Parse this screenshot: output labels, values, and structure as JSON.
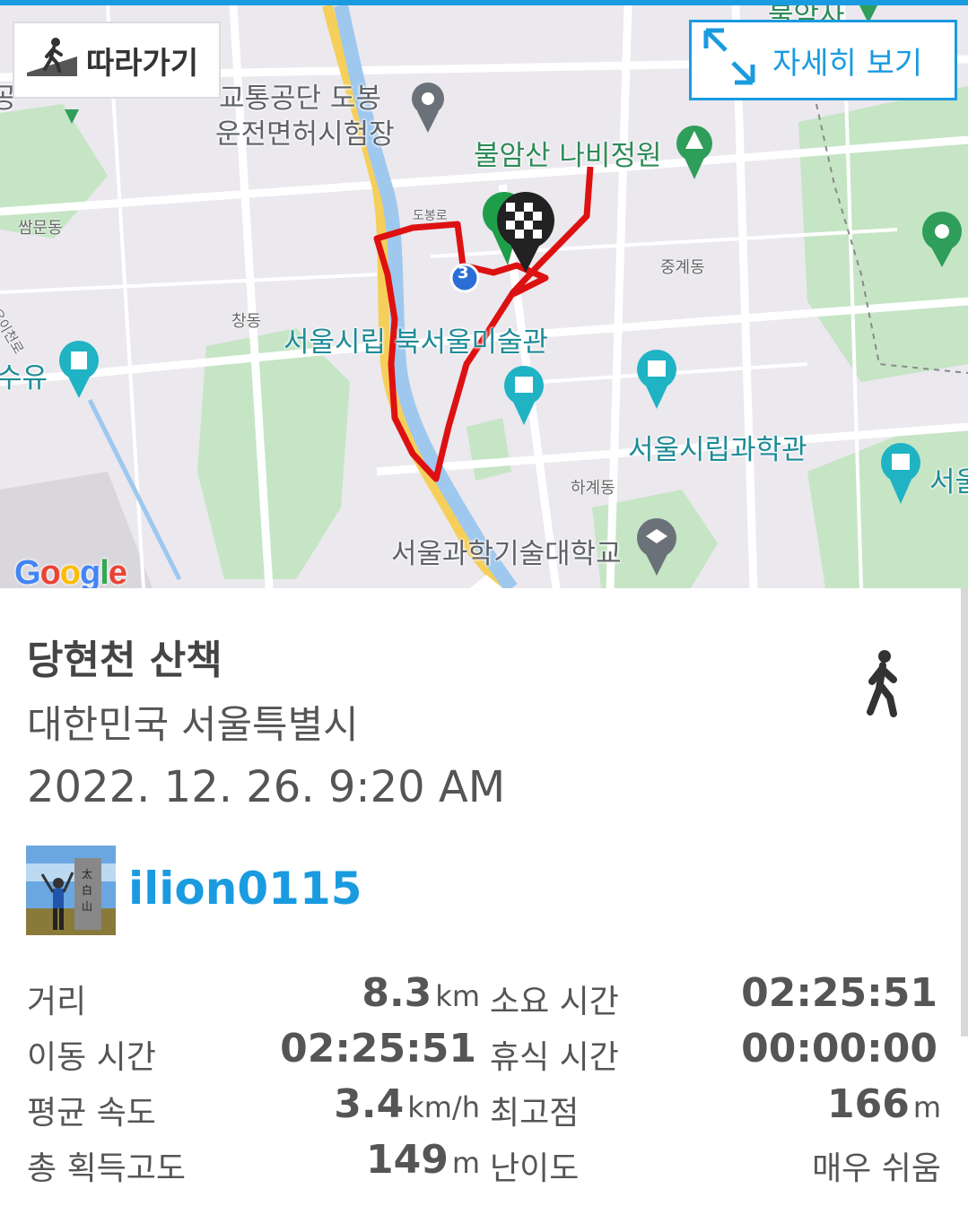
{
  "map": {
    "follow_label": "따라가기",
    "detail_label": "자세히 보기",
    "google_logo": "Google",
    "labels": {
      "driving_test": "교통공단 도봉",
      "driving_test2": "운전면허시험장",
      "butterfly": "불암산 나비정원",
      "ssangmun": "쌈문동",
      "junggye": "중계동",
      "changdong": "창동",
      "museum": "서울시립 북서울미술관",
      "suyu": "수유",
      "science_hall": "서울시립과학관",
      "hagye": "하계동",
      "seoultech": "서울과학기술대학교",
      "seoul_edge": "서울",
      "route_no": "3",
      "road_small": "도봉로",
      "top_partial": "불암사",
      "left_edge": "공",
      "left_road": "우이천로"
    }
  },
  "track": {
    "title": "당현천 산책",
    "location": "대한민국 서울특별시",
    "date": "2022. 12. 26. 9:20 AM",
    "activity_icon": "walking-icon"
  },
  "user": {
    "username": "ilion0115",
    "avatar_icon": "user-avatar"
  },
  "stats": {
    "distance_label": "거리",
    "distance_value": "8.3",
    "distance_unit": "km",
    "duration_label": "소요 시간",
    "duration_value": "02:25:51",
    "moving_label": "이동 시간",
    "moving_value": "02:25:51",
    "rest_label": "휴식 시간",
    "rest_value": "00:00:00",
    "avg_speed_label": "평균 속도",
    "avg_speed_value": "3.4",
    "avg_speed_unit": "km/h",
    "max_alt_label": "최고점",
    "max_alt_value": "166",
    "max_alt_unit": "m",
    "gain_label": "총 획득고도",
    "gain_value": "149",
    "gain_unit": "m",
    "difficulty_label": "난이도",
    "difficulty_value": "매우 쉬움"
  },
  "colors": {
    "accent": "#1a9be0",
    "route": "#dd1111",
    "park": "#bfe0c0",
    "water": "#9fc8ef"
  }
}
